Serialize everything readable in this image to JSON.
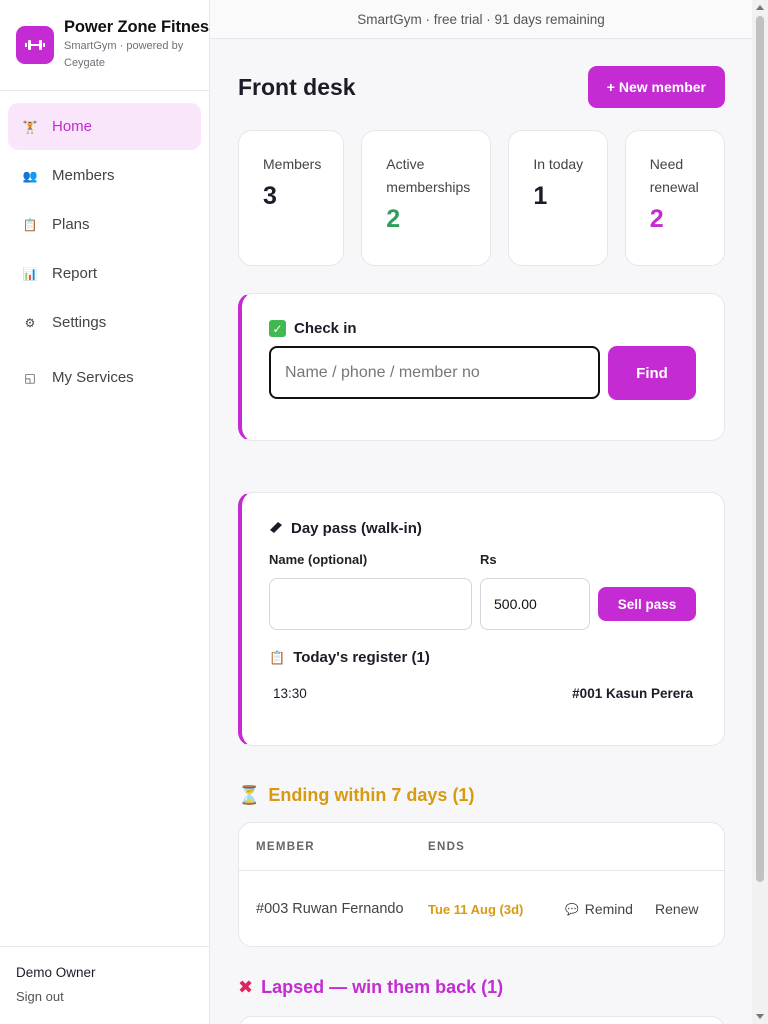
{
  "brand": {
    "name": "Power Zone Fitness",
    "subtitle": "SmartGym · powered by Ceygate",
    "logo_icon": "dumbbell-icon"
  },
  "nav": [
    {
      "label": "Home",
      "icon": "🏋",
      "active": true
    },
    {
      "label": "Members",
      "icon": "👥"
    },
    {
      "label": "Plans",
      "icon": "📋"
    },
    {
      "label": "Report",
      "icon": "📊"
    },
    {
      "label": "Settings",
      "icon": "⚙"
    },
    {
      "label": "My Services",
      "icon": "◱"
    }
  ],
  "user": {
    "name": "Demo Owner",
    "sign_out": "Sign out"
  },
  "banner": "SmartGym · free trial · 91 days remaining",
  "page": {
    "title": "Front desk",
    "new_member": "+ New member"
  },
  "stats": [
    {
      "label": "Members",
      "value": "3",
      "color": "#1c1c28"
    },
    {
      "label": "Active memberships",
      "value": "2",
      "color": "#2e9e5a"
    },
    {
      "label": "In today",
      "value": "1",
      "color": "#1c1c28"
    },
    {
      "label": "Need renewal",
      "value": "2",
      "color": "#c42bd2"
    }
  ],
  "checkin": {
    "title": "Check in",
    "placeholder": "Name / phone / member no",
    "find": "Find"
  },
  "daypass": {
    "title": "Day pass (walk-in)",
    "name_label": "Name (optional)",
    "amount_label": "Rs",
    "amount_value": "500.00",
    "sell": "Sell pass"
  },
  "register": {
    "title": "Today's register (1)",
    "rows": [
      {
        "time": "13:30",
        "name": "#001 Kasun Perera"
      }
    ]
  },
  "ending": {
    "title": "Ending within 7 days (1)",
    "headers": [
      "MEMBER",
      "ENDS"
    ],
    "rows": [
      {
        "member": "#003 Ruwan Fernando",
        "ends": "Tue 11 Aug (3d)",
        "remind": "Remind",
        "renew": "Renew"
      }
    ]
  },
  "lapsed": {
    "title": "Lapsed — win them back (1)"
  },
  "colors": {
    "accent": "#c42bd2",
    "warning": "#d89a10",
    "success": "#2e9e5a"
  }
}
